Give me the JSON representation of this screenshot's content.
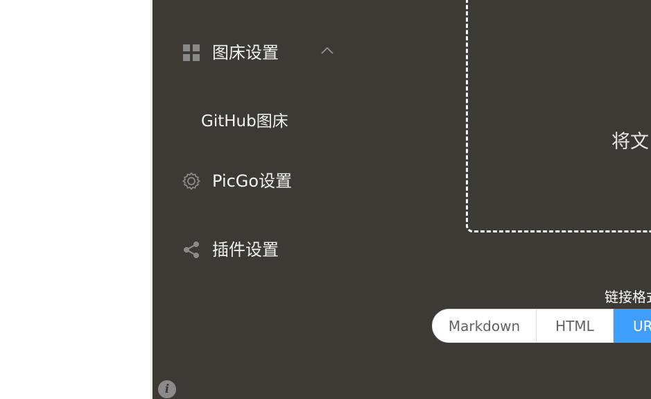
{
  "sidebar": {
    "items": [
      {
        "label": "图床设置",
        "icon": "grid-icon",
        "expanded": true
      },
      {
        "label": "GitHub图床",
        "icon": null,
        "sub": true
      },
      {
        "label": "PicGo设置",
        "icon": "gear-icon"
      },
      {
        "label": "插件设置",
        "icon": "share-icon"
      }
    ]
  },
  "upload": {
    "text": "将文"
  },
  "link_format": {
    "label": "链接格式",
    "options": [
      "Markdown",
      "HTML",
      "UR"
    ],
    "selected": "UR"
  },
  "colors": {
    "sidebar_bg": "#3d3a36",
    "accent": "#409eff",
    "icon_grey": "#8a8a8a"
  },
  "info_icon": "info-icon"
}
